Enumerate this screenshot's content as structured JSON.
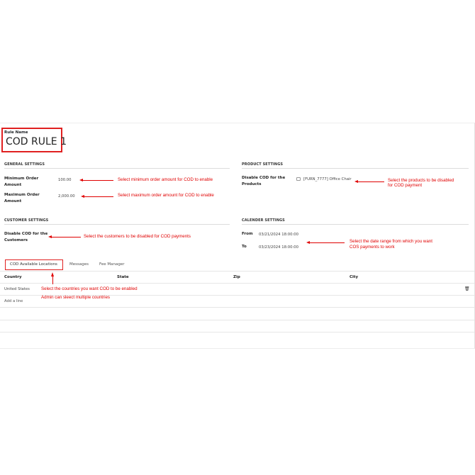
{
  "rule": {
    "label": "Rule Name",
    "value": "COD RULE 1"
  },
  "general": {
    "title": "GENERAL SETTINGS",
    "min_label": "Minimum Order Amount",
    "min_value": "100.00",
    "max_label": "Maximum Order Amount",
    "max_value": "2,000.00"
  },
  "product": {
    "title": "PRODUCT SETTINGS",
    "disable_label": "Disable COD for the Products",
    "product_value": "[FURN_7777] Office Chair"
  },
  "customer": {
    "title": "CUSTOMER SETTINGS",
    "disable_label": "Disable COD for the Customers"
  },
  "calendar": {
    "title": "CALENDER SETTINGS",
    "from_label": "From",
    "from_value": "03/21/2024 18:00:00",
    "to_label": "To",
    "to_value": "03/23/2024 18:00:00"
  },
  "tabs": [
    "COD Available Locations",
    "Messages",
    "Fee Manager"
  ],
  "table": {
    "columns": [
      "Country",
      "State",
      "Zip",
      "City"
    ],
    "rows": [
      {
        "country": "United States"
      }
    ],
    "add_line": "Add a line"
  },
  "annotations": {
    "min": "Select minimum order amount for COD to enable",
    "max": "Select maximum order amount for COD to enable",
    "products_1": "Select the products to be disabled",
    "products_2": "for COD payment",
    "customers": "Select the customers to be disabled for COD payments",
    "dates_1": "Select the date range from which you want",
    "dates_2": "COS payments to work",
    "countries_1": "Select the countries you want COD to be enabled",
    "countries_2": "Admin can sleect multiple countries"
  },
  "colors": {
    "annotation": "#e00000",
    "highlight_border": "#e02020"
  }
}
